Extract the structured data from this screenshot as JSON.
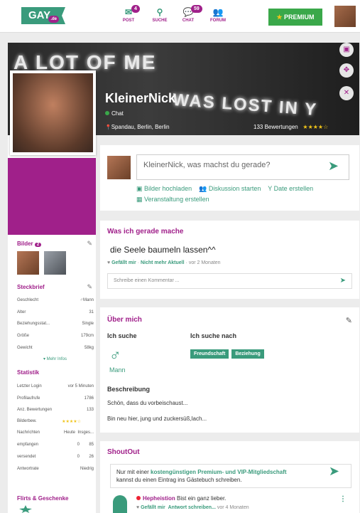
{
  "header": {
    "logo": "GAY",
    "logo_tld": ".de",
    "nav": [
      {
        "label": "POST",
        "badge": "4",
        "icon": "post-icon",
        "glyph": "✉"
      },
      {
        "label": "SUCHE",
        "badge": "",
        "icon": "search-icon",
        "glyph": "⚲"
      },
      {
        "label": "CHAT",
        "badge": "59",
        "icon": "chat-icon",
        "glyph": "💬"
      },
      {
        "label": "FORUM",
        "badge": "",
        "icon": "forum-icon",
        "glyph": "👥"
      }
    ],
    "premium": "PREMIUM",
    "premium_icon": "★"
  },
  "cover": {
    "line1": "A LOT OF ME",
    "line2": "WAS LOST IN Y",
    "name": "KleinerNick",
    "status": "Chat",
    "location": "Spandau, Berlin, Berlin",
    "location_icon": "📍",
    "reviews": "133 Bewertungen",
    "stars": "★★★★☆",
    "buttons": [
      {
        "icon": "image-icon",
        "glyph": "▣"
      },
      {
        "icon": "move-icon",
        "glyph": "✥"
      },
      {
        "icon": "close-icon",
        "glyph": "✕"
      }
    ]
  },
  "composer": {
    "placeholder": "KleinerNick, was machst du gerade?",
    "send_icon": "➤",
    "actions": [
      {
        "icon": "image-icon",
        "glyph": "▣",
        "label": "Bilder hochladen"
      },
      {
        "icon": "people-icon",
        "glyph": "👥",
        "label": "Diskussion starten"
      },
      {
        "icon": "cocktail-icon",
        "glyph": "Y",
        "label": "Date erstellen"
      },
      {
        "icon": "calendar-icon",
        "glyph": "▦",
        "label": "Veranstaltung erstellen"
      }
    ]
  },
  "activity": {
    "title": "Was ich gerade mache",
    "text": "die Seele baumeln lassen^^",
    "like": "Gefällt mir",
    "notcurrent": "Nicht mehr Aktuell",
    "sep": "·",
    "time": "vor 2 Monaten",
    "comment_placeholder": "Schreibe einen Kommentar ...",
    "send_icon": "➤"
  },
  "about": {
    "title": "Über mich",
    "edit_icon": "✎",
    "seek": "Ich suche",
    "seek_for": "Ich suche nach",
    "gender_symbol": "♂",
    "gender": "Mann",
    "tags": [
      "Freundschaft",
      "Beziehung"
    ],
    "desc_title": "Beschreibung",
    "desc1": "Schön, dass du vorbeischaust...",
    "desc2": "Bin neu hier, jung und zuckersüß,lach..."
  },
  "shoutout": {
    "title": "ShoutOut",
    "notice_pre": "Nur mit einer ",
    "notice_link": "kostengünstigen Premium- und VIP-Mitgliedschaft",
    "notice_post": "kannst du einen Eintrag ins Gästebuch schreiben.",
    "send_icon": "➤",
    "user": "Hepheistion",
    "message": "Bist ein ganz lieber.",
    "like": "Gefällt mir",
    "reply": "Antwort schreiben...",
    "time": "vor 4 Monaten",
    "menu_icon": "⋮"
  },
  "sidebar": {
    "bilder": "Bilder",
    "bilder_count": "2",
    "steckbrief": "Steckbrief",
    "edit_icon": "✎",
    "facts": [
      [
        "Geschlecht",
        "♂Mann"
      ],
      [
        "Alter",
        "31"
      ],
      [
        "Beziehungsstat...",
        "Single"
      ],
      [
        "Größe",
        "179cm"
      ],
      [
        "Gewicht",
        "58kg"
      ]
    ],
    "more": "▾ Mehr Infos",
    "statistik": "Statistik",
    "stats": [
      [
        "Letzter Login",
        "vor 5 Minuten"
      ],
      [
        "Profilaufrufe",
        "1786"
      ],
      [
        "Anz. Bewertungen",
        "133"
      ]
    ],
    "rating_label": "Bilderbew.",
    "rating_stars": "★★★★☆",
    "msg_head": [
      "Nachrichten",
      "Heute",
      "Insges..."
    ],
    "msgs": [
      [
        "empfangen",
        "0",
        "85"
      ],
      [
        "versendet",
        "0",
        "26"
      ]
    ],
    "answer_rate": [
      "Antwortrate",
      "Niedrig"
    ],
    "flirts": "Flirts & Geschenke"
  }
}
